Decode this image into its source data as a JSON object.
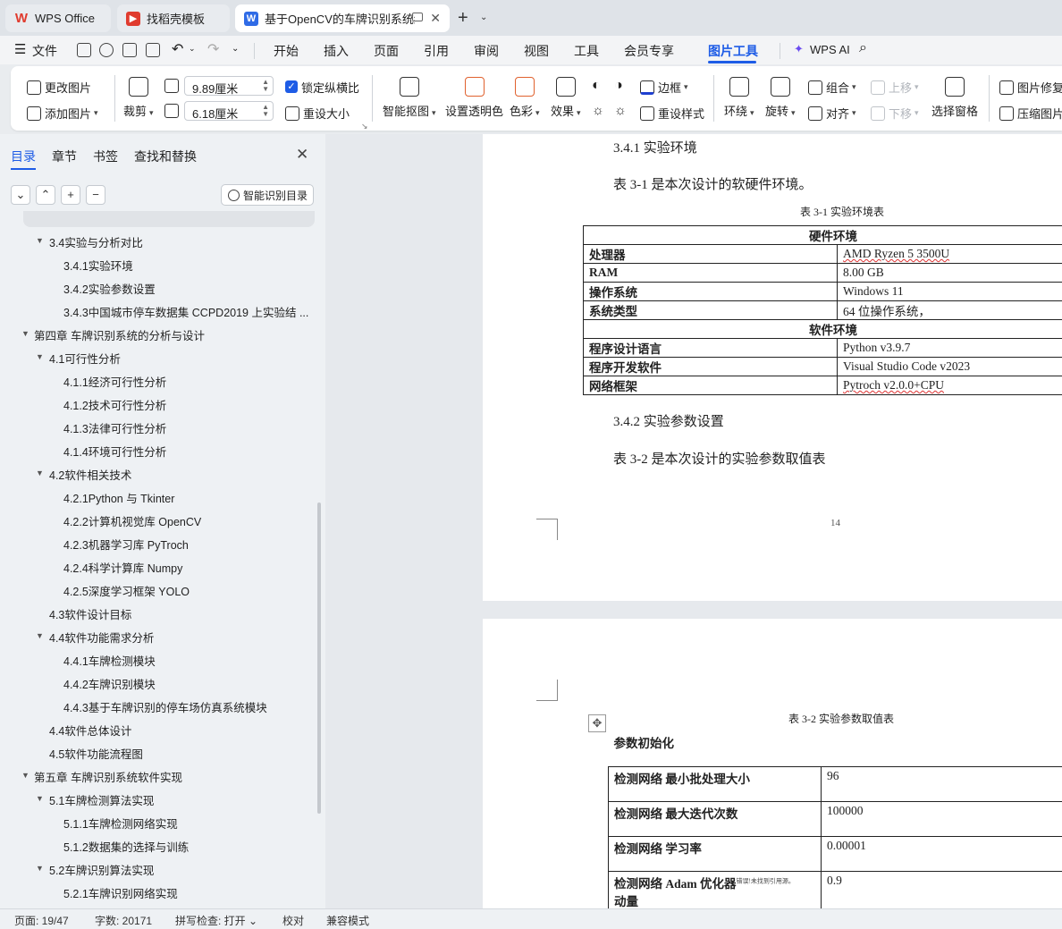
{
  "tabs": [
    {
      "label": "WPS Office"
    },
    {
      "label": "找稻壳模板"
    },
    {
      "label": "基于OpenCV的车牌识别系统结"
    }
  ],
  "menu": {
    "file": "文件",
    "items": [
      "开始",
      "插入",
      "页面",
      "引用",
      "审阅",
      "视图",
      "工具",
      "会员专享",
      "图片工具",
      "WPS AI"
    ]
  },
  "ribbon": {
    "change_image": "更改图片",
    "add_image": "添加图片",
    "crop": "裁剪",
    "width_value": "9.89厘米",
    "height_value": "6.18厘米",
    "lock_ratio": "锁定纵横比",
    "reset_size": "重设大小",
    "smart_cutout": "智能抠图",
    "set_transparent": "设置透明色",
    "color": "色彩",
    "effects": "效果",
    "border": "边框",
    "reset_style": "重设样式",
    "wrap": "环绕",
    "rotate": "旋转",
    "group": "组合",
    "align": "对齐",
    "move_up": "上移",
    "move_down": "下移",
    "selection_pane": "选择窗格",
    "image_repair": "图片修复",
    "compress_image": "压缩图片"
  },
  "leftpanel": {
    "tabs": [
      "目录",
      "章节",
      "书签",
      "查找和替换"
    ],
    "smart_toc": "智能识别目录",
    "toc": [
      "3.4实验与分析对比",
      "3.4.1实验环境",
      "3.4.2实验参数设置",
      "3.4.3中国城市停车数据集 CCPD2019 上实验结 ...",
      "第四章 车牌识别系统的分析与设计",
      "4.1可行性分析",
      "4.1.1经济可行性分析",
      "4.1.2技术可行性分析",
      "4.1.3法律可行性分析",
      "4.1.4环境可行性分析",
      "4.2软件相关技术",
      "4.2.1Python 与 Tkinter",
      "4.2.2计算机视觉库 OpenCV",
      "4.2.3机器学习库 PyTroch",
      "4.2.4科学计算库 Numpy",
      "4.2.5深度学习框架 YOLO",
      "4.3软件设计目标",
      "4.4软件功能需求分析",
      "4.4.1车牌检测模块",
      "4.4.2车牌识别模块",
      "4.4.3基于车牌识别的停车场仿真系统模块",
      "4.4软件总体设计",
      "4.5软件功能流程图",
      "第五章 车牌识别系统软件实现",
      "5.1车牌检测算法实现",
      "5.1.1车牌检测网络实现",
      "5.1.2数据集的选择与训练",
      "5.2车牌识别算法实现",
      "5.2.1车牌识别网络实现"
    ]
  },
  "doc": {
    "heading_341": "3.4.1 实验环境",
    "para_1": "表  3-1 是本次设计的软硬件环境。",
    "caption_1": "表  3-1  实验环境表",
    "hardware_header": "硬件环境",
    "software_header": "软件环境",
    "env_rows": [
      {
        "k": "处理器",
        "v": "AMD Ryzen 5 3500U"
      },
      {
        "k": "RAM",
        "v": "8.00 GB"
      },
      {
        "k": "操作系统",
        "v": "Windows 11"
      },
      {
        "k": "系统类型",
        "v": "64 位操作系统，"
      },
      {
        "k": "程序设计语言",
        "v": "Python v3.9.7"
      },
      {
        "k": "程序开发软件",
        "v": "Visual Studio Code v2023"
      },
      {
        "k": "网络框架",
        "v": "Pytroch v2.0.0+CPU"
      }
    ],
    "heading_342": "3.4.2 实验参数设置",
    "para_2": "表  3-2 是本次设计的实验参数取值表",
    "page_number": "14",
    "caption_2": "表  3-2  实验参数取值表",
    "param_header": "参数初始化",
    "param_rows": [
      {
        "k": "检测网络    最小批处理大小",
        "v": "96"
      },
      {
        "k": "检测网络    最大迭代次数",
        "v": "100000"
      },
      {
        "k": "检测网络    学习率",
        "v": "0.00001"
      },
      {
        "k": "检测网络    Adam 优化器",
        "note": "错误!未找到引用源。",
        "k2": "动量",
        "v": "0.9"
      }
    ]
  },
  "status": {
    "page": "页面: 19/47",
    "words": "字数: 20171",
    "spell": "拼写检查: 打开",
    "proof": "校对",
    "compat": "兼容模式"
  }
}
